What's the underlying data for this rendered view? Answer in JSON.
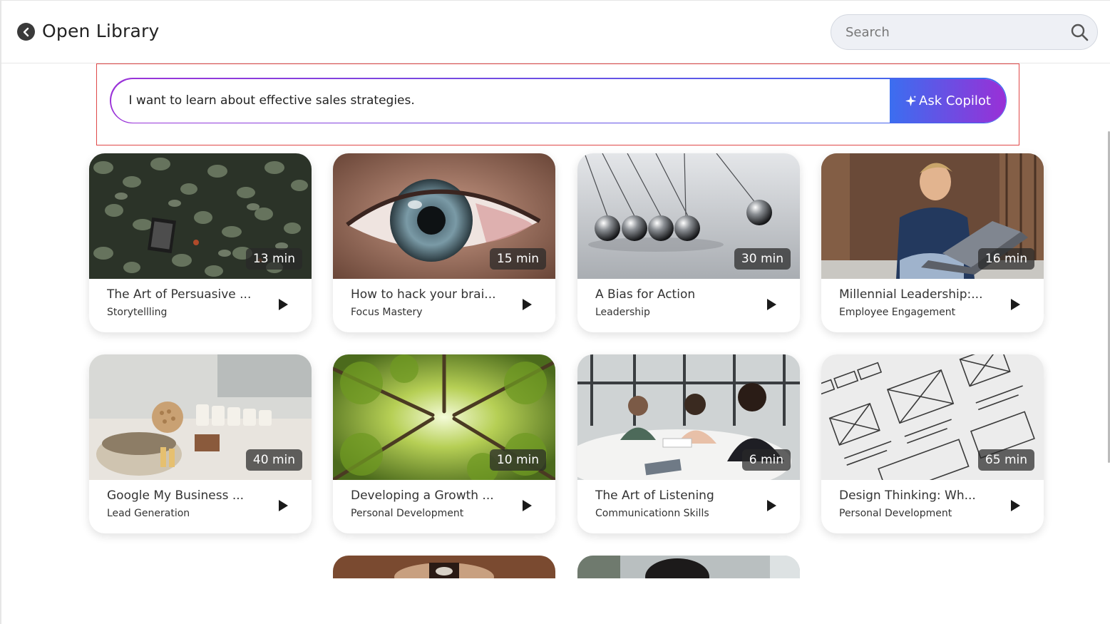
{
  "header": {
    "title": "Open Library",
    "search_placeholder": "Search"
  },
  "copilot": {
    "input_value": "I want to learn about effective sales strategies.",
    "button_label": "Ask Copilot"
  },
  "colors": {
    "accent_purple": "#9b33d8",
    "accent_blue": "#3a6cf0",
    "highlight_border": "#e04848"
  },
  "cards": [
    {
      "title": "The Art of Persuasive ...",
      "category": "Storytellling",
      "duration": "13 min",
      "thumbnail": "ivy-leaves-with-book"
    },
    {
      "title": "How to hack your brai...",
      "category": "Focus Mastery",
      "duration": "15 min",
      "thumbnail": "closeup-eye"
    },
    {
      "title": "A Bias for Action",
      "category": "Leadership",
      "duration": "30 min",
      "thumbnail": "newtons-cradle"
    },
    {
      "title": "Millennial Leadership:...",
      "category": "Employee Engagement",
      "duration": "16 min",
      "thumbnail": "man-with-laptop"
    },
    {
      "title": "Google My Business ...",
      "category": "Lead Generation",
      "duration": "40 min",
      "thumbnail": "shop-shelf-products"
    },
    {
      "title": "Developing a Growth ...",
      "category": "Personal Development",
      "duration": "10 min",
      "thumbnail": "forest-canopy"
    },
    {
      "title": "The Art of Listening",
      "category": "Communicationn Skills",
      "duration": "6 min",
      "thumbnail": "women-meeting"
    },
    {
      "title": "Design Thinking: Wh...",
      "category": "Personal Development",
      "duration": "65 min",
      "thumbnail": "wireframe-sketch"
    }
  ]
}
